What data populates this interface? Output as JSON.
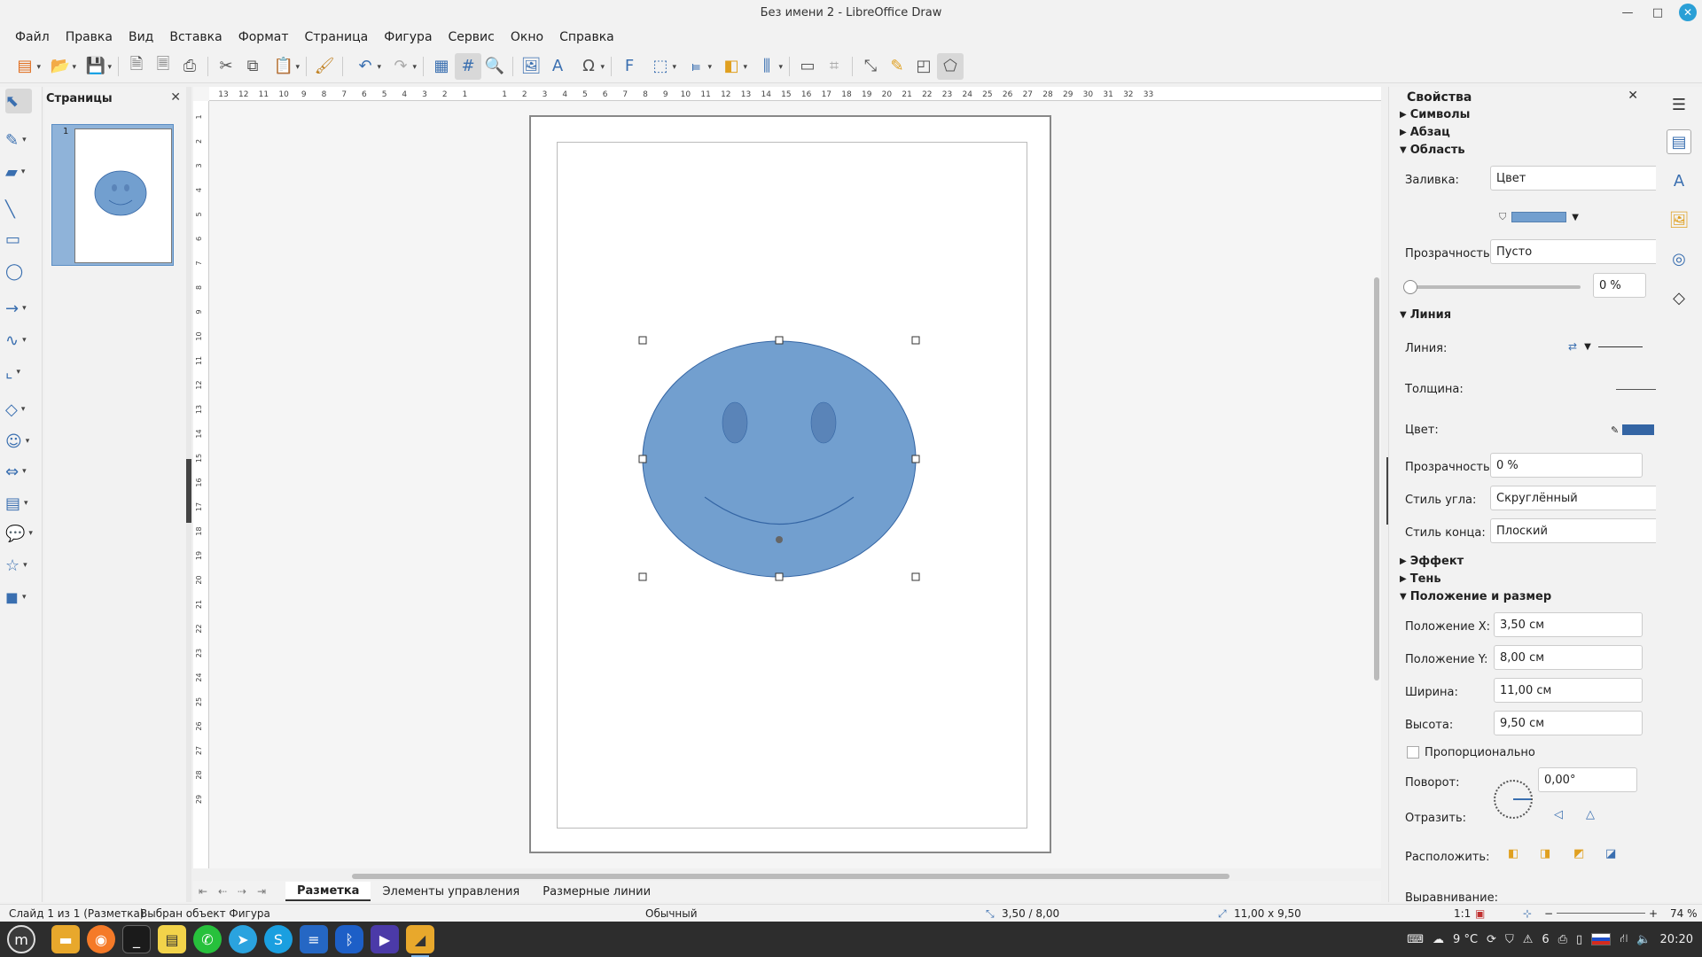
{
  "window": {
    "title": "Без имени 2 - LibreOffice Draw"
  },
  "menu": [
    "Файл",
    "Правка",
    "Вид",
    "Вставка",
    "Формат",
    "Страница",
    "Фигура",
    "Сервис",
    "Окно",
    "Справка"
  ],
  "pages_pane": {
    "title": "Страницы",
    "thumb_number": "1"
  },
  "hruler_ticks": [
    "13",
    "12",
    "11",
    "10",
    "9",
    "8",
    "7",
    "6",
    "5",
    "4",
    "3",
    "2",
    "1",
    "1",
    "2",
    "3",
    "4",
    "5",
    "6",
    "7",
    "8",
    "9",
    "10",
    "11",
    "12",
    "13",
    "14",
    "15",
    "16",
    "17",
    "18",
    "19",
    "20",
    "21",
    "22",
    "23",
    "24",
    "25",
    "26",
    "27",
    "28",
    "29",
    "30",
    "31",
    "32",
    "33"
  ],
  "vruler_ticks": [
    "1",
    "2",
    "3",
    "4",
    "5",
    "6",
    "7",
    "8",
    "9",
    "10",
    "11",
    "12",
    "13",
    "14",
    "15",
    "16",
    "17",
    "18",
    "19",
    "20",
    "21",
    "22",
    "23",
    "24",
    "25",
    "26",
    "27",
    "28",
    "29"
  ],
  "tabs": [
    "Разметка",
    "Элементы управления",
    "Размерные линии"
  ],
  "sidebar": {
    "title": "Свойства",
    "sections": {
      "symbols": "Символы",
      "paragraph": "Абзац",
      "area": "Область",
      "line": "Линия",
      "effect": "Эффект",
      "shadow": "Тень",
      "possize": "Положение и размер"
    },
    "area": {
      "fill_label": "Заливка:",
      "fill_value": "Цвет",
      "transp_label": "Прозрачность:",
      "transp_value": "Пусто",
      "transp_pct": "0 %"
    },
    "line": {
      "line_label": "Линия:",
      "width_label": "Толщина:",
      "color_label": "Цвет:",
      "transp_label": "Прозрачность:",
      "transp_value": "0 %",
      "corner_label": "Стиль угла:",
      "corner_value": "Скруглённый",
      "cap_label": "Стиль конца:",
      "cap_value": "Плоский"
    },
    "possize": {
      "x_label": "Положение X:",
      "x_value": "3,50 см",
      "y_label": "Положение Y:",
      "y_value": "8,00 см",
      "w_label": "Ширина:",
      "w_value": "11,00 см",
      "h_label": "Высота:",
      "h_value": "9,50 см",
      "prop_label": "Пропорционально",
      "rot_label": "Поворот:",
      "rot_value": "0,00°",
      "flip_label": "Отразить:",
      "arrange_label": "Расположить:",
      "align_label": "Выравнивание:"
    }
  },
  "status": {
    "slide": "Слайд 1 из 1 (Разметка)",
    "selection": "Выбран объект Фигура",
    "style": "Обычный",
    "pos": "3,50 / 8,00",
    "size": "11,00 x 9,50",
    "scale": "1:1",
    "zoom": "74 %"
  },
  "tray": {
    "weather": "9 °C",
    "notif": "6",
    "time": "20:20"
  },
  "colors": {
    "shape_fill": "#729fcf",
    "shape_line": "#3465a4",
    "eye_fill": "#5a84b8",
    "accent": "#3a6fb0"
  }
}
